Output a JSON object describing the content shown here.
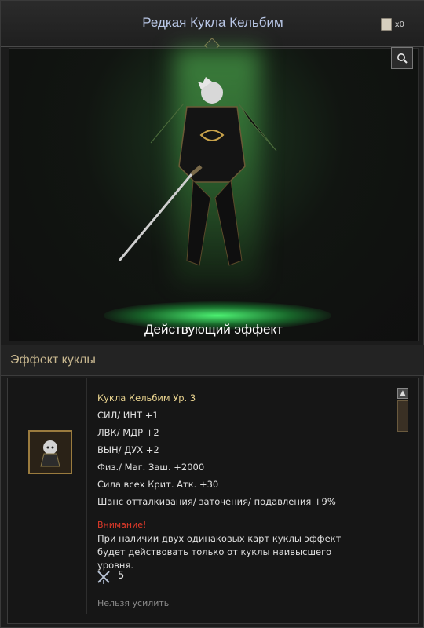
{
  "window": {
    "title": "Редкая Кукла Кельбим",
    "card_count": "x0"
  },
  "showcase": {
    "effect_label": "Действующий эффект"
  },
  "section": {
    "title": "Эффект куклы"
  },
  "doll": {
    "name": "Кукла Кельбим Ур. 3",
    "stats": [
      "СИЛ/ ИНТ +1",
      "ЛВК/ МДР +2",
      "ВЫН/ ДУХ +2",
      "Физ./ Маг. Заш. +2000",
      "Сила всех Крит. Атк. +30",
      "Шанс отталкивания/ заточения/ подавления +9%"
    ],
    "warning": "Внимание!",
    "note": "При наличии двух одинаковых карт куклы эффект будет действовать только от куклы наивысшего уровня.",
    "enhance_count": "5",
    "cannot_enhance": "Нельзя усилить"
  },
  "colors": {
    "title": "#b9c7e6",
    "section_title": "#c8b78f",
    "doll_name": "#e9d38f",
    "warning": "#e23a2a",
    "glow": "#50ff78"
  },
  "icons": {
    "cards": "card-stack-icon",
    "search": "magnifier-icon",
    "scroll_up": "arrow-up-icon",
    "enhance": "crossed-swords-icon",
    "doll": "kelbim-portrait-icon"
  }
}
